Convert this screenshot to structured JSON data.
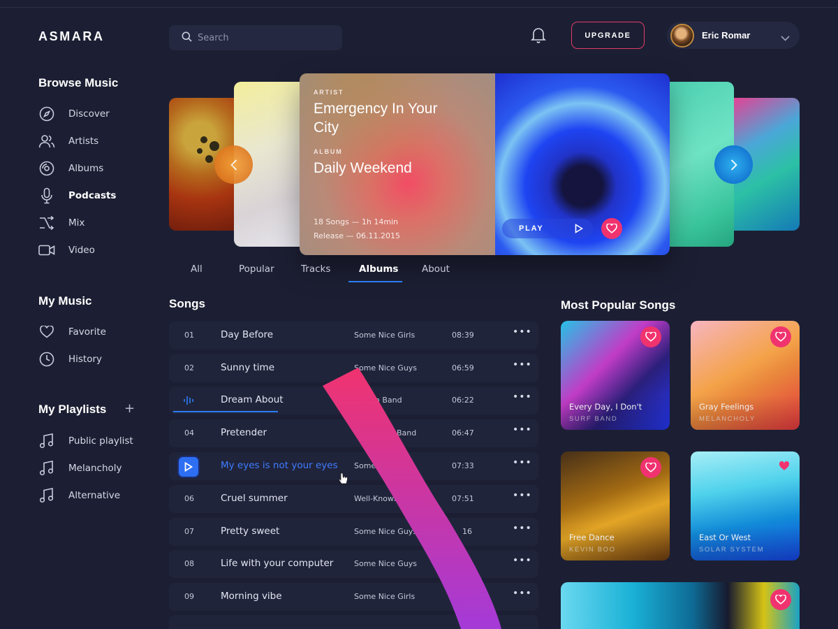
{
  "app": {
    "logo": "ASMARA"
  },
  "sidebar": {
    "browse_title": "Browse Music",
    "browse_items": [
      {
        "label": "Discover",
        "icon": "compass-icon"
      },
      {
        "label": "Artists",
        "icon": "users-icon"
      },
      {
        "label": "Albums",
        "icon": "disc-icon"
      },
      {
        "label": "Podcasts",
        "icon": "microphone-icon"
      },
      {
        "label": "Mix",
        "icon": "shuffle-icon"
      },
      {
        "label": "Video",
        "icon": "video-icon"
      }
    ],
    "my_music_title": "My Music",
    "my_music_items": [
      {
        "label": "Favorite",
        "icon": "heart-icon"
      },
      {
        "label": "History",
        "icon": "clock-icon"
      }
    ],
    "playlists_title": "My Playlists",
    "add_label": "+",
    "playlists": [
      {
        "label": "Public playlist",
        "icon": "music-note-icon"
      },
      {
        "label": "Melancholy",
        "icon": "music-note-icon"
      },
      {
        "label": "Alternative",
        "icon": "music-note-icon"
      }
    ]
  },
  "header": {
    "search_placeholder": "Search",
    "upgrade_label": "UPGRADE",
    "user_name": "Eric Romar"
  },
  "featured": {
    "artist_label": "ARTIST",
    "artist_title_line1": "Emergency In Your",
    "artist_title_line2": "City",
    "album_label": "ALBUM",
    "album_title": "Daily Weekend",
    "songs_meta": "18 Songs — 1h 14min",
    "release_meta": "Release — 06.11.2015",
    "play_label": "PLAY"
  },
  "tabs": [
    {
      "label": "All"
    },
    {
      "label": "Popular"
    },
    {
      "label": "Tracks"
    },
    {
      "label": "Albums",
      "active": true
    },
    {
      "label": "About"
    }
  ],
  "songs": {
    "title": "Songs",
    "rows": [
      {
        "num": "01",
        "title": "Day Before",
        "artist": "Some Nice Girls",
        "duration": "08:39"
      },
      {
        "num": "02",
        "title": "Sunny time",
        "artist": "Some Nice Guys",
        "duration": "06:59"
      },
      {
        "num": "",
        "title": "Dream About",
        "artist": "Known Band",
        "duration": "06:22"
      },
      {
        "num": "04",
        "title": "Pretender",
        "artist": "Band",
        "duration": "06:47"
      },
      {
        "num": "",
        "title": "My eyes is not your eyes",
        "artist": "Some",
        "duration": "07:33"
      },
      {
        "num": "06",
        "title": "Cruel summer",
        "artist": "Well-Known",
        "duration": "07:51"
      },
      {
        "num": "07",
        "title": "Pretty sweet",
        "artist": "Some Nice Guys",
        "duration": "16"
      },
      {
        "num": "08",
        "title": "Life with your computer",
        "artist": "Some Nice Guys",
        "duration": ""
      },
      {
        "num": "09",
        "title": "Morning vibe",
        "artist": "Some Nice Girls",
        "duration": ""
      }
    ],
    "more_label": "•••"
  },
  "popular": {
    "title": "Most Popular Songs",
    "items": [
      {
        "name": "Every Day, I Don't",
        "artist": "SURF BAND"
      },
      {
        "name": "Gray Feelings",
        "artist": "MELANCHOLY"
      },
      {
        "name": "Free Dance",
        "artist": "KEVIN BOO"
      },
      {
        "name": "East Or West",
        "artist": "SOLAR SYSTEM"
      }
    ]
  },
  "colors": {
    "background": "#1c1f33",
    "accent_blue": "#2d7dfa",
    "accent_pink": "#f0336f"
  }
}
